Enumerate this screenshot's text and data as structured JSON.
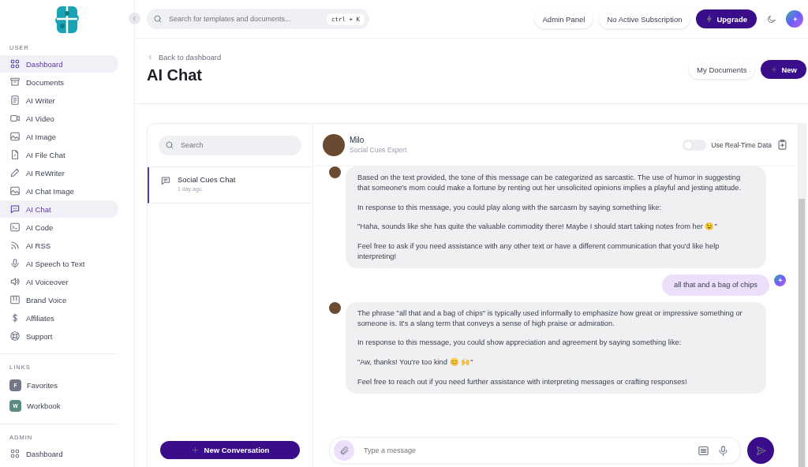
{
  "sidebar": {
    "sections": [
      {
        "label": "USER",
        "items": [
          {
            "label": "Dashboard",
            "selected": true
          },
          {
            "label": "Documents",
            "selected": false
          },
          {
            "label": "AI Writer",
            "selected": false
          },
          {
            "label": "AI Video",
            "selected": false
          },
          {
            "label": "AI Image",
            "selected": false
          },
          {
            "label": "AI File Chat",
            "selected": false
          },
          {
            "label": "AI ReWriter",
            "selected": false
          },
          {
            "label": "AI Chat Image",
            "selected": false
          },
          {
            "label": "AI Chat",
            "selected": true
          },
          {
            "label": "AI Code",
            "selected": false
          },
          {
            "label": "AI RSS",
            "selected": false
          },
          {
            "label": "AI Speech to Text",
            "selected": false
          },
          {
            "label": "AI Voiceover",
            "selected": false
          },
          {
            "label": "Brand Voice",
            "selected": false
          },
          {
            "label": "Affiliates",
            "selected": false
          },
          {
            "label": "Support",
            "selected": false
          }
        ]
      },
      {
        "label": "LINKS",
        "links": [
          {
            "letter": "F",
            "label": "Favorites",
            "color": "#737888"
          },
          {
            "letter": "W",
            "label": "Workbook",
            "color": "#5a8a84"
          }
        ]
      },
      {
        "label": "ADMIN",
        "items": [
          {
            "label": "Dashboard",
            "selected": false
          }
        ]
      }
    ]
  },
  "topbar": {
    "search_placeholder": "Search for templates and documents...",
    "shortcut": "ctrl + K",
    "buttons": [
      "Admin Panel",
      "No Active Subscription"
    ],
    "upgrade": "Upgrade"
  },
  "header": {
    "back": "Back to dashboard",
    "title": "AI Chat",
    "my_documents": "My Documents",
    "new": "New"
  },
  "conversations": {
    "search_placeholder": "Search",
    "items": [
      {
        "title": "Social Cues Chat",
        "time": "1 day ago",
        "selected": true
      }
    ],
    "new_button": "New Conversation"
  },
  "chat": {
    "name": "Milo",
    "role": "Social Cues Expert",
    "realtime": {
      "label": "Use Real-Time Data",
      "on": false
    },
    "messages": [
      {
        "kind": "bot",
        "paragraphs": [
          "Based on the text provided, the tone of this message can be categorized as sarcastic. The use of humor in suggesting that someone's mom could make a fortune by renting out her unsolicited opinions implies a playful and jesting attitude.",
          "In response to this message, you could play along with the sarcasm by saying something like:",
          "\"Haha, sounds like she has quite the valuable commodity there! Maybe I should start taking notes from her 😉\"",
          "Feel free to ask if you need assistance with any other text or have a different communication that you'd like help interpreting!"
        ]
      },
      {
        "kind": "user",
        "paragraphs": [
          "all that and a bag of chips"
        ]
      },
      {
        "kind": "bot",
        "paragraphs": [
          "The phrase \"all that and a bag of chips\" is typically used informally to emphasize how great or impressive something or someone is. It's a slang term that conveys a sense of high praise or admiration.",
          "In response to this message, you could show appreciation and agreement by saying something like:",
          "\"Aw, thanks! You're too kind 😊 🙌\"",
          "Feel free to reach out if you need further assistance with interpreting messages or crafting responses!"
        ]
      }
    ],
    "input_placeholder": "Type a message"
  }
}
